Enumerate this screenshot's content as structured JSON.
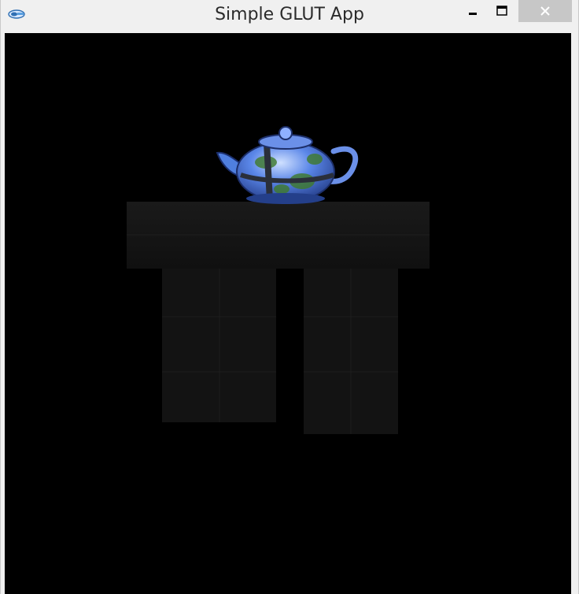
{
  "window": {
    "title": "Simple GLUT App",
    "icons": {
      "app": "glut-app-icon",
      "minimize": "minimize-icon",
      "maximize": "maximize-icon",
      "close": "close-icon"
    }
  },
  "scene": {
    "objects": [
      "teapot",
      "table"
    ],
    "colors": {
      "background": "#000000",
      "teapot_primary": "#5a86e8",
      "teapot_highlight": "#cfe0ff",
      "teapot_foliage": "#3f7a2a",
      "table": "#161616"
    }
  }
}
